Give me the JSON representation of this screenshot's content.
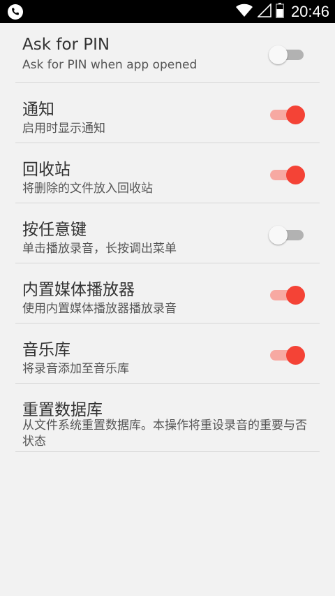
{
  "status_bar": {
    "time": "20:46",
    "left_icon": "phone-icon",
    "wifi_icon": "wifi-icon",
    "signal_icon": "signal-icon",
    "battery_icon": "battery-icon"
  },
  "colors": {
    "accent": "#f44336",
    "track_on": "#f7a9a2",
    "track_off": "#b2b2b2"
  },
  "settings": [
    {
      "title": "Ask for PIN",
      "subtitle": "Ask for PIN when app opened",
      "toggle": false
    },
    {
      "title": "通知",
      "subtitle": "启用时显示通知",
      "toggle": true
    },
    {
      "title": "回收站",
      "subtitle": "将删除的文件放入回收站",
      "toggle": true
    },
    {
      "title": "按任意键",
      "subtitle": "单击播放录音，长按调出菜单",
      "toggle": false
    },
    {
      "title": "内置媒体播放器",
      "subtitle": "使用内置媒体播放器播放录音",
      "toggle": true
    },
    {
      "title": "音乐库",
      "subtitle": "将录音添加至音乐库",
      "toggle": true
    },
    {
      "title": "重置数据库",
      "subtitle": "从文件系统重置数据库。本操作将重设录音的重要与否状态"
    }
  ]
}
